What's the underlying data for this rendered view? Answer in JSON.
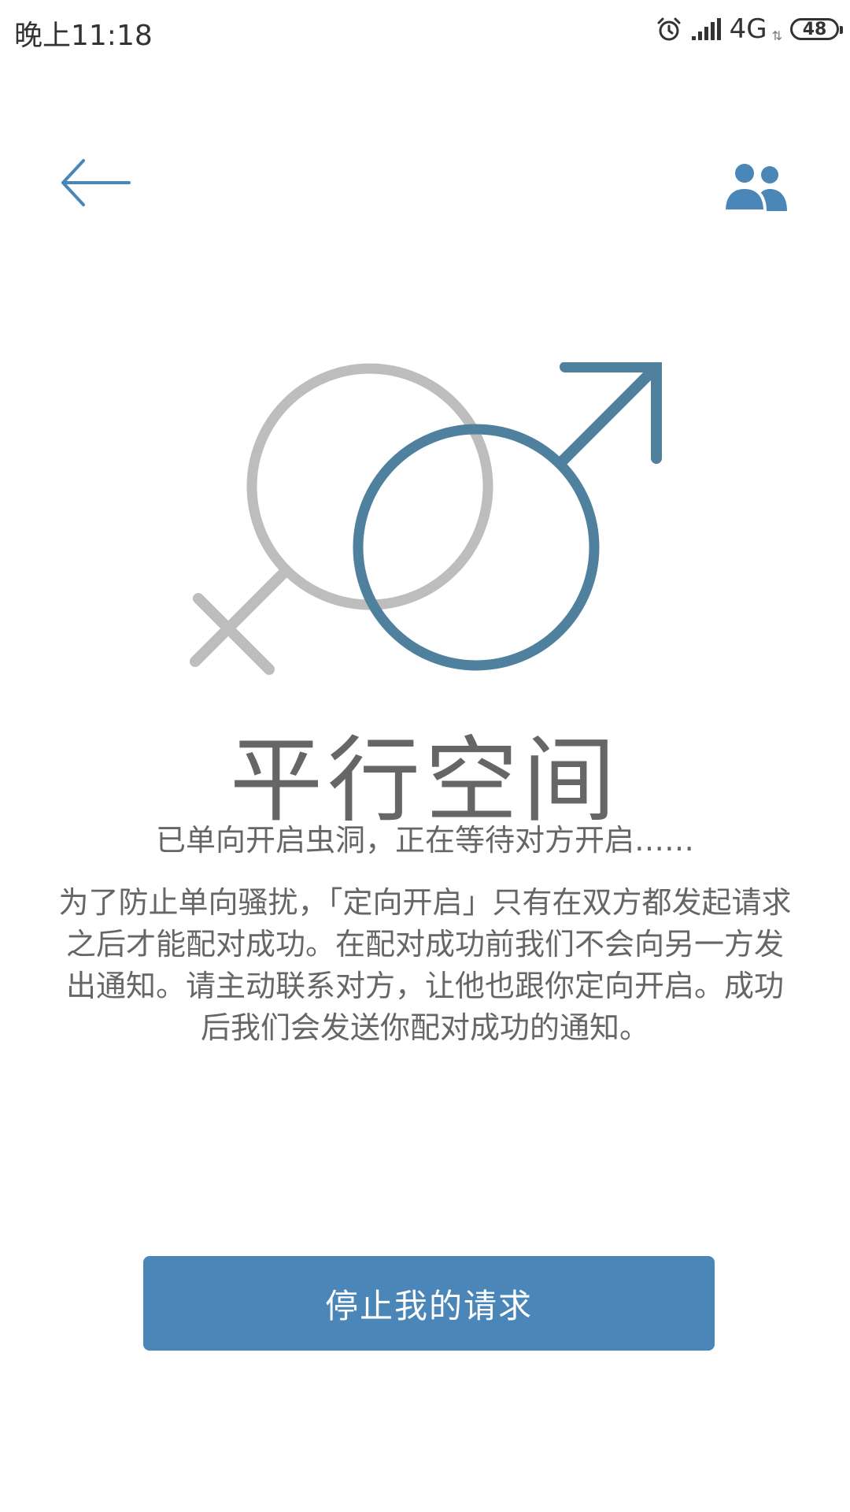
{
  "status_bar": {
    "time": "晚上11:18",
    "network": "4G",
    "network_arrows": "⇅",
    "battery": "48",
    "icons": [
      "alarm-icon",
      "signal-icon",
      "battery-icon"
    ]
  },
  "header": {
    "back_icon": "arrow-left-icon",
    "friends_icon": "people-icon"
  },
  "main": {
    "title": "平行空间",
    "subtitle": "已单向开启虫洞，正在等待对方开启……",
    "explanation": "为了防止单向骚扰，「定向开启」只有在双方都发起请求之后才能配对成功。在配对成功前我们不会向另一方发出通知。请主动联系对方，让他也跟你定向开启。成功后我们会发送你配对成功的通知。",
    "illustration": "female-male-symbols"
  },
  "actions": {
    "stop_label": "停止我的请求"
  },
  "colors": {
    "primary": "#4a86b8",
    "male_symbol": "#4f819f",
    "female_symbol": "#bdbdbd",
    "text_gray": "#666666"
  }
}
